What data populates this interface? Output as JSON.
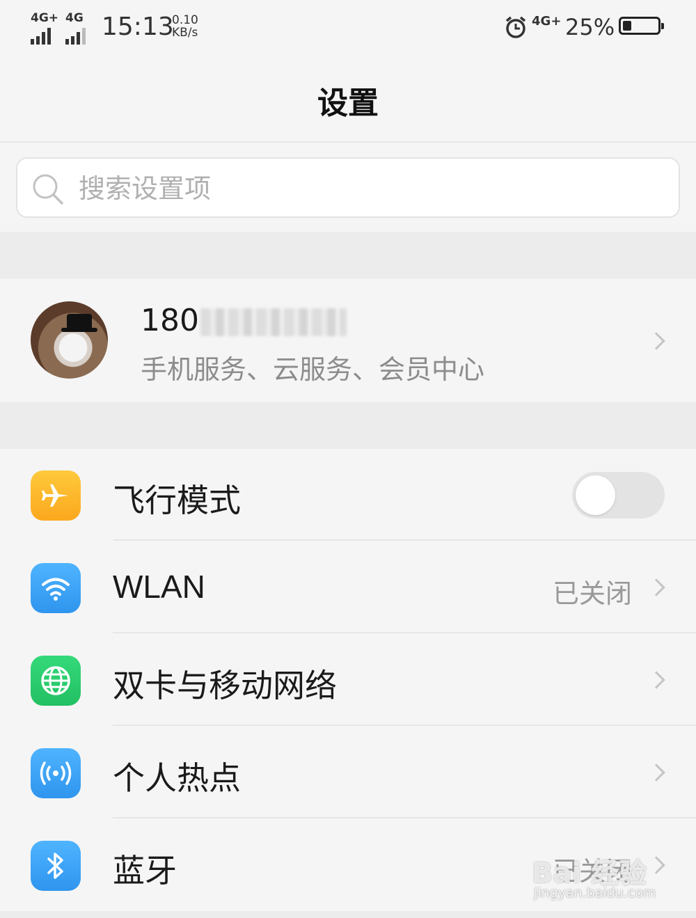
{
  "status_bar": {
    "signal1_label": "4G",
    "signal1_plus": "+",
    "signal2_label": "4G",
    "time": "15:13",
    "speed_value": "0.10",
    "speed_unit": "KB/s",
    "net_label": "4G",
    "net_plus": "+",
    "battery_percent": "25%",
    "battery_level": 0.25
  },
  "header": {
    "title": "设置"
  },
  "search": {
    "placeholder": "搜索设置项",
    "value": ""
  },
  "account": {
    "phone_visible": "180",
    "subtitle": "手机服务、云服务、会员中心"
  },
  "settings": [
    {
      "key": "airplane",
      "label": "飞行模式",
      "icon": "airplane-icon",
      "color": "#fdb92c",
      "toggle_on": false
    },
    {
      "key": "wlan",
      "label": "WLAN",
      "value": "已关闭",
      "icon": "wifi-icon",
      "color": "#3aa3f5"
    },
    {
      "key": "mobile-network",
      "label": "双卡与移动网络",
      "icon": "globe-icon",
      "color": "#2ccf6e"
    },
    {
      "key": "hotspot",
      "label": "个人热点",
      "icon": "hotspot-icon",
      "color": "#3aa3f5"
    },
    {
      "key": "bluetooth",
      "label": "蓝牙",
      "value": "已关闭",
      "icon": "bluetooth-icon",
      "color": "#3aa3f5"
    }
  ],
  "watermark": {
    "text": "Bai 经验",
    "url": "jingyan.baidu.com"
  }
}
